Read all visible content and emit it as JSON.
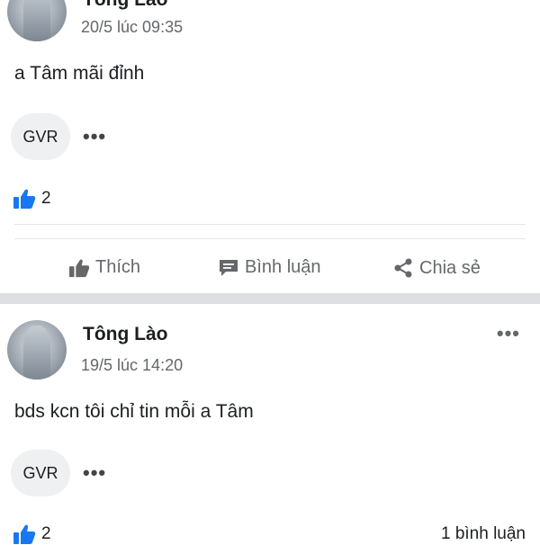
{
  "posts": [
    {
      "author": "Tông Lào",
      "time": "20/5 lúc 09:35",
      "text": "a Tâm mãi đỉnh",
      "group_tag": "GVR",
      "likes": "2"
    },
    {
      "author": "Tông Lào",
      "time": "19/5 lúc 14:20",
      "text": "bds kcn tôi chỉ tin mỗi a Tâm",
      "group_tag": "GVR",
      "likes": "2",
      "comments": "1 bình luận"
    }
  ],
  "actions": {
    "like": "Thích",
    "comment": "Bình luận",
    "share": "Chia sẻ"
  },
  "more_glyph": "•••",
  "icons": [
    "thumbs-up-icon",
    "comment-icon",
    "share-icon",
    "more-icon",
    "avatar"
  ],
  "colors": {
    "like_blue": "#1877f2",
    "muted": "#65676b",
    "separator": "#dddee1"
  }
}
